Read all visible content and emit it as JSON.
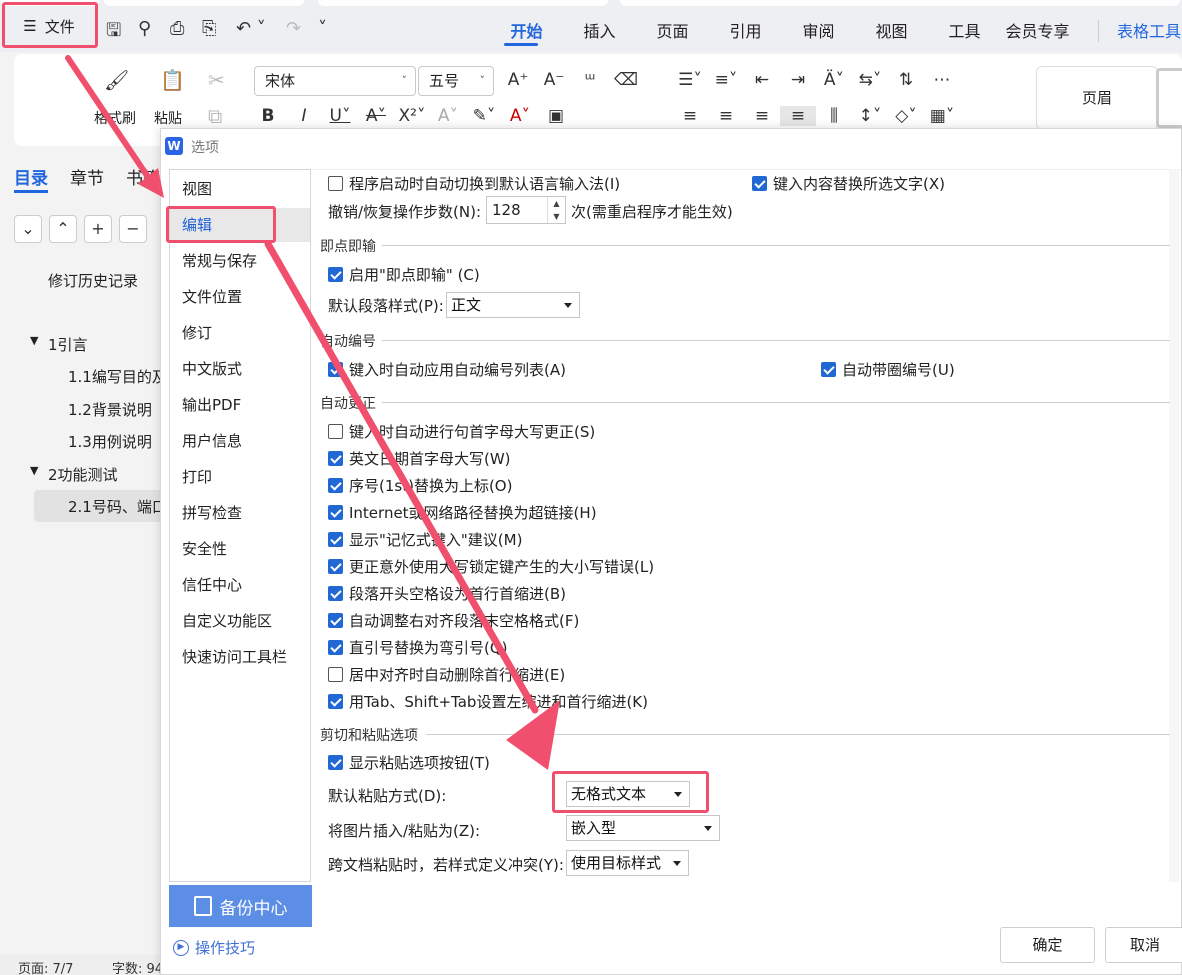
{
  "app": {
    "file_menu_label": "文件",
    "tabs": [
      "开始",
      "插入",
      "页面",
      "引用",
      "审阅",
      "视图",
      "工具",
      "会员专享"
    ],
    "active_tab": "开始",
    "table_tools_label": "表格工具"
  },
  "ribbon": {
    "format_painter_label": "格式刷",
    "paste_label": "粘贴",
    "font_name": "宋体",
    "font_size": "五号",
    "header_label": "页眉"
  },
  "nav_pane": {
    "tabs": [
      "目录",
      "章节",
      "书签"
    ],
    "active_tab": "目录",
    "history_label": "修订历史记录",
    "toc": [
      {
        "label": "1引言",
        "level": 1
      },
      {
        "label": "1.1编写目的及",
        "level": 2
      },
      {
        "label": "1.2背景说明",
        "level": 2
      },
      {
        "label": "1.3用例说明",
        "level": 2
      },
      {
        "label": "2功能测试",
        "level": 1
      },
      {
        "label": "2.1号码、端口",
        "level": 2
      }
    ]
  },
  "statusbar": {
    "page": "页面: 7/7",
    "words": "字数: 94"
  },
  "dialog": {
    "title": "选项",
    "sidebar": [
      "视图",
      "编辑",
      "常规与保存",
      "文件位置",
      "修订",
      "中文版式",
      "输出PDF",
      "用户信息",
      "打印",
      "拼写检查",
      "安全性",
      "信任中心",
      "自定义功能区",
      "快速访问工具栏"
    ],
    "active_sidebar": "编辑",
    "backup_label": "备份中心",
    "tips_label": "操作技巧",
    "ok_label": "确定",
    "cancel_label": "取消",
    "top": {
      "auto_switch_ime": "程序启动时自动切换到默认语言输入法(I)",
      "replace_selection": "键入内容替换所选文字(X)",
      "undo_steps_label": "撤销/恢复操作步数(N):",
      "undo_steps_value": "128",
      "undo_steps_note": "次(需重启程序才能生效)"
    },
    "click_and_type": {
      "heading": "即点即输",
      "enable_label": "启用\"即点即输\" (C)",
      "default_style_label": "默认段落样式(P):",
      "default_style_value": "正文"
    },
    "auto_numbering": {
      "heading": "自动编号",
      "list_label": "键入时自动应用自动编号列表(A)",
      "circle_label": "自动带圈编号(U)"
    },
    "autocorrect": {
      "heading": "自动更正",
      "items": [
        {
          "label": "键入时自动进行句首字母大写更正(S)",
          "checked": false
        },
        {
          "label": "英文日期首字母大写(W)",
          "checked": true
        },
        {
          "label": "序号(1st)替换为上标(O)",
          "checked": true
        },
        {
          "label": "Internet或网络路径替换为超链接(H)",
          "checked": true
        },
        {
          "label": "显示\"记忆式键入\"建议(M)",
          "checked": true
        },
        {
          "label": "更正意外使用大写锁定键产生的大小写错误(L)",
          "checked": true
        },
        {
          "label": "段落开头空格设为首行首缩进(B)",
          "checked": true
        },
        {
          "label": "自动调整右对齐段落末空格格式(F)",
          "checked": true
        },
        {
          "label": "直引号替换为弯引号(Q)",
          "checked": true
        },
        {
          "label": "居中对齐时自动删除首行缩进(E)",
          "checked": false
        },
        {
          "label": "用Tab、Shift+Tab设置左缩进和首行缩进(K)",
          "checked": true
        }
      ]
    },
    "paste": {
      "heading": "剪切和粘贴选项",
      "show_button_label": "显示粘贴选项按钮(T)",
      "default_paste_label": "默认粘贴方式(D):",
      "default_paste_value": "无格式文本",
      "image_insert_label": "将图片插入/粘贴为(Z):",
      "image_insert_value": "嵌入型",
      "cross_doc_label": "跨文档粘贴时，若样式定义冲突(Y):",
      "cross_doc_value": "使用目标样式"
    }
  },
  "colors": {
    "accent": "#2266dd",
    "highlight": "#f0506e",
    "backup_bg": "#5b8ee4"
  }
}
